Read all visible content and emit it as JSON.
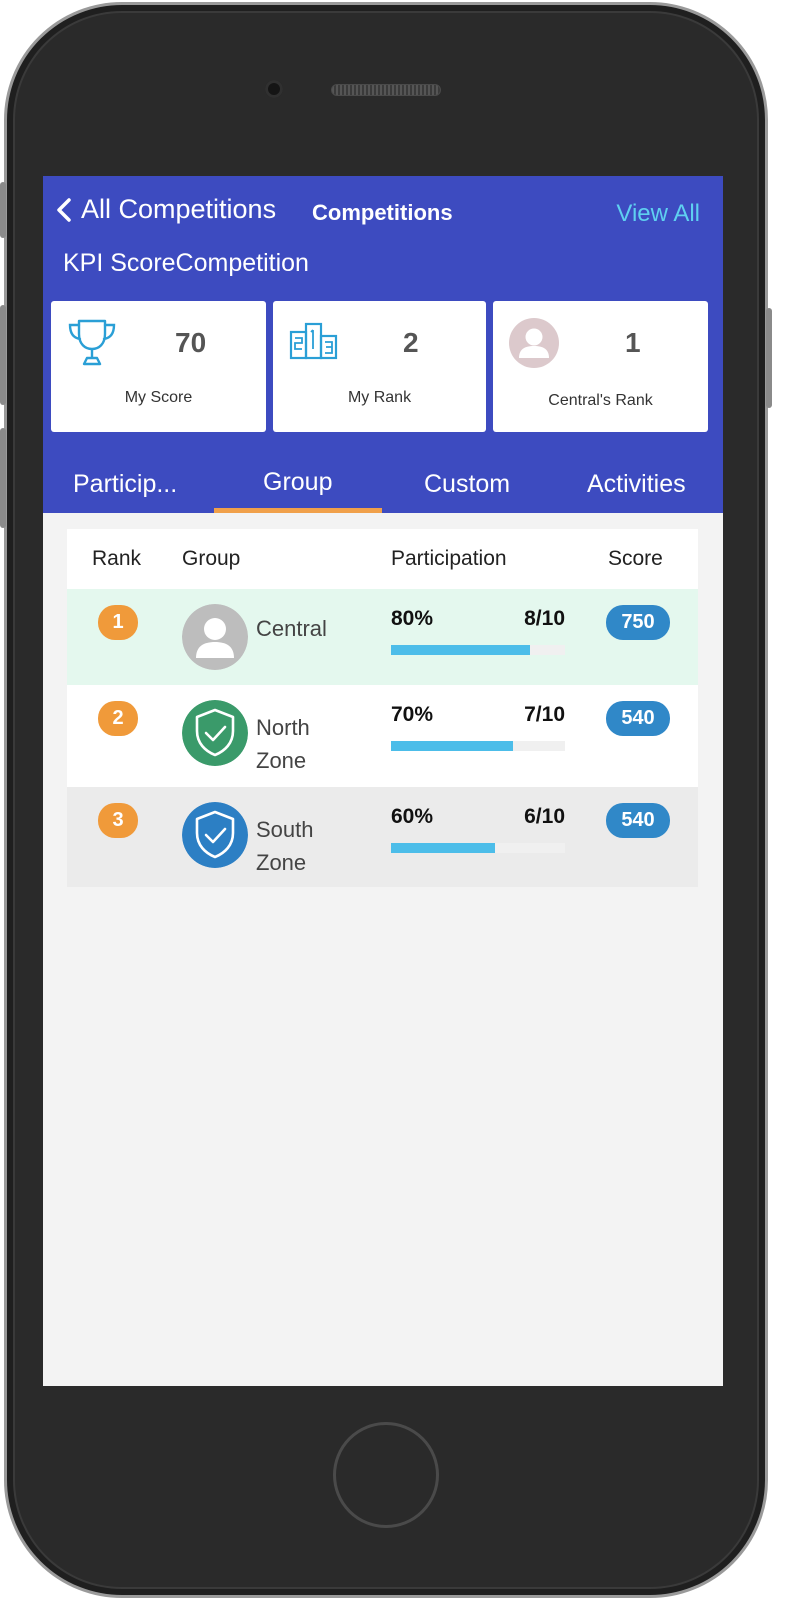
{
  "header": {
    "back_label": "All Competitions",
    "title": "Competitions",
    "view_all_label": "View All",
    "competition_name": "KPI ScoreCompetition"
  },
  "stats": [
    {
      "icon": "trophy-icon",
      "value": "70",
      "label": "My Score"
    },
    {
      "icon": "podium-icon",
      "value": "2",
      "label": "My Rank"
    },
    {
      "icon": "avatar-icon",
      "value": "1",
      "label": "Central's Rank"
    }
  ],
  "tabs": [
    {
      "label": "Particip...",
      "active": false
    },
    {
      "label": "Group",
      "active": true
    },
    {
      "label": "Custom",
      "active": false
    },
    {
      "label": "Activities",
      "active": false
    }
  ],
  "table": {
    "columns": [
      "Rank",
      "Group",
      "Participation",
      "Score"
    ],
    "rows": [
      {
        "rank": "1",
        "name": "Central",
        "avatar": "person-avatar-icon",
        "participation_pct": "80%",
        "participation_ratio": "8/10",
        "progress": 0.8,
        "score": "750"
      },
      {
        "rank": "2",
        "name": "North Zone",
        "avatar": "shield-check-icon",
        "participation_pct": "70%",
        "participation_ratio": "7/10",
        "progress": 0.7,
        "score": "540"
      },
      {
        "rank": "3",
        "name": "South Zone",
        "avatar": "shield-check-icon",
        "participation_pct": "60%",
        "participation_ratio": "6/10",
        "progress": 0.6,
        "score": "540"
      }
    ]
  },
  "colors": {
    "header_bg": "#3d4bc0",
    "accent_link": "#5fd0f0",
    "tab_indicator": "#f09a3a",
    "rank_badge": "#f09a3a",
    "score_pill": "#3088c8",
    "progress_fill": "#4cbde9",
    "north_zone_avatar": "#3a9a6a",
    "south_zone_avatar": "#2c7fc4"
  }
}
